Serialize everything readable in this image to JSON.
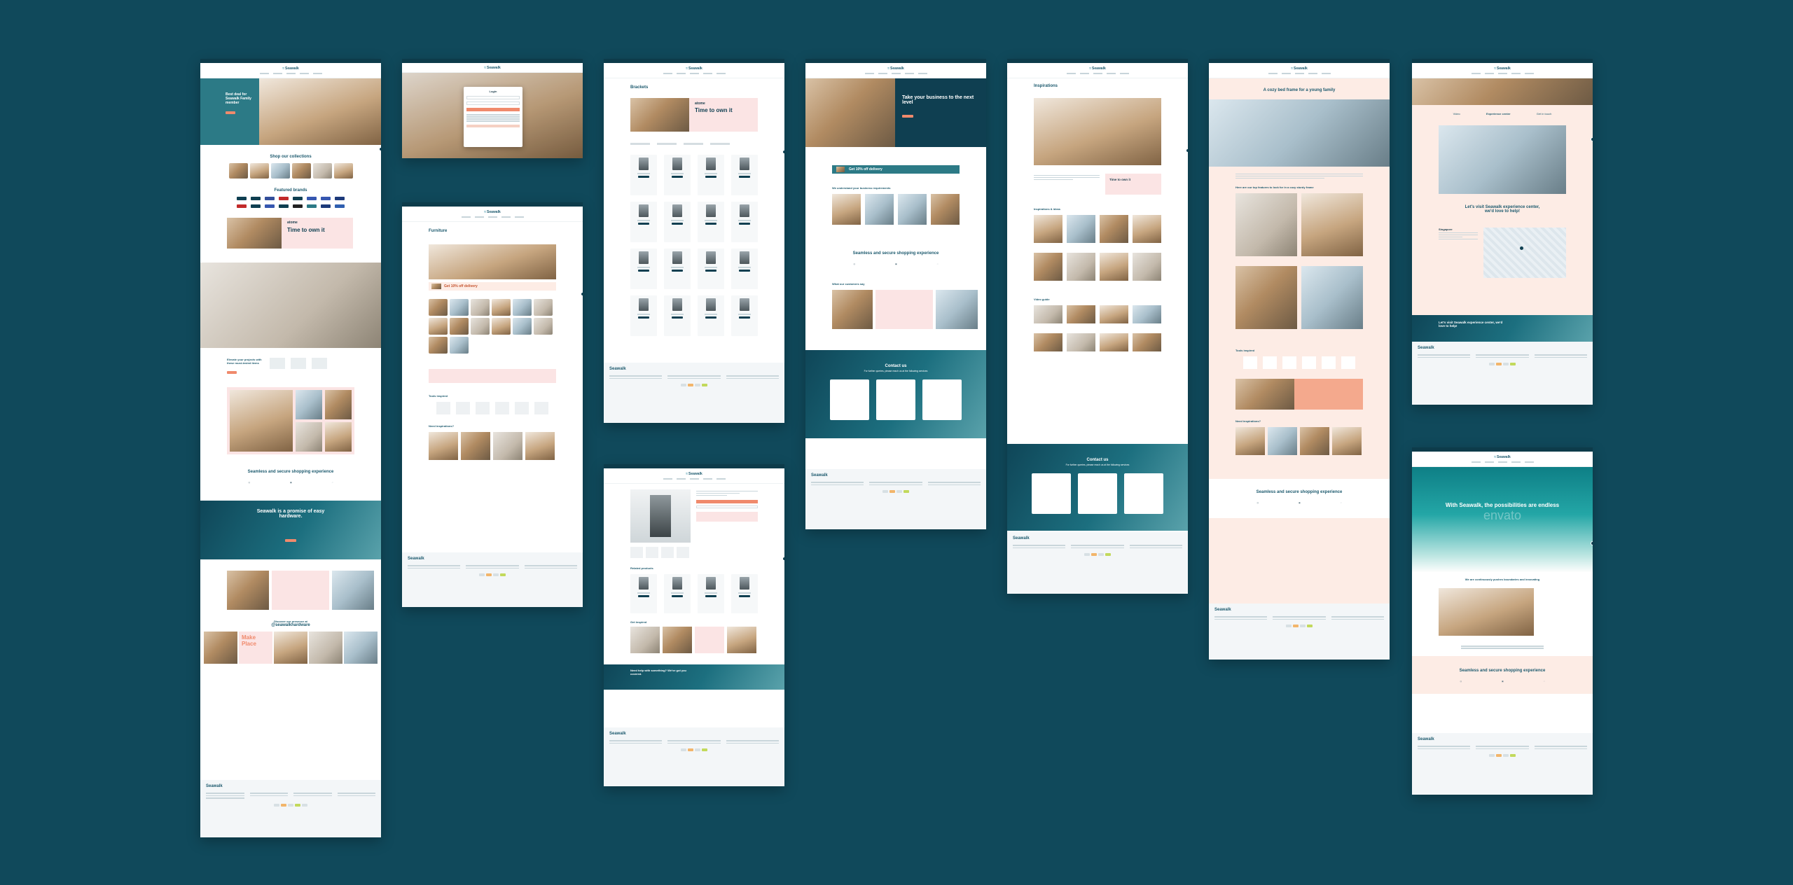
{
  "brand": {
    "name": "Seawalk",
    "colors": {
      "background": "#10495b",
      "primary": "#0f3f51",
      "accent": "#f08a6c",
      "pink": "#fbe4e4",
      "teal": "#2c7a86"
    }
  },
  "pages": {
    "home": {
      "hero_title": "Best deal for Seawalk Family member",
      "collections_title": "Shop our collections",
      "brands_title": "Featured brands",
      "promo_brand": "atome",
      "promo_title": "Time to own it",
      "elevate_title": "Elevate your projects with these must-tested items",
      "seamless_title": "Seamless and secure shopping experience",
      "promise_title": "Seawalk is a promise of easy hardware.",
      "instagram_title": "Discover our presence at",
      "instagram_handle": "@seawalkhardware",
      "insta_pink_text": "Make Place"
    },
    "login": {
      "title": "Login"
    },
    "furniture": {
      "title": "Furniture",
      "delivery_text": "Get 10% off delivery",
      "tools_title": "Tools inspired",
      "inspiration_title": "Need inspirations?"
    },
    "brackets": {
      "title": "Brackets",
      "promo_brand": "atome",
      "promo_title": "Time to own it"
    },
    "product": {
      "related_title": "Related products",
      "inspired_title": "Get inspired",
      "help_title": "Need help with something? We've got you covered."
    },
    "business": {
      "hero_title": "Take your business to the next level",
      "delivery_text": "Get 10% off delivery",
      "requirements_title": "We understand your business requirements",
      "seamless_title": "Seamless and secure shopping experience",
      "customers_title": "What our customers say",
      "contact_title": "Contact us",
      "contact_sub": "For further queries, please reach us at the following services"
    },
    "inspirations": {
      "title": "Inspirations",
      "ideas_title": "Inspirations & ideas",
      "video_title": "Video guide",
      "promo_title": "Time to own it",
      "contact_title": "Contact us",
      "contact_sub": "For further queries, please reach us at the following services"
    },
    "article": {
      "title": "A cozy bed frame for a young family",
      "features_title": "Here are our top features to look for in a cozy sturdy frame",
      "tools_title": "Tools inspired",
      "inspiration_title": "Need inspirations?",
      "seamless_title": "Seamless and secure shopping experience"
    },
    "experience": {
      "tabs": [
        "Video",
        "Experience center",
        "Get in touch"
      ],
      "visit_title": "Let's visit Seawalk experience center, we'd love to help!",
      "location": "Singapore",
      "banner_title": "Let's visit Seawalk experience center, we'd love to help!"
    },
    "about": {
      "hero_title": "With Seawalk, the possibilities are endless",
      "watermark": "envato",
      "mission_title": "We are continuously pushes boundaries and innovating",
      "seamless_title": "Seamless and secure shopping experience"
    }
  }
}
